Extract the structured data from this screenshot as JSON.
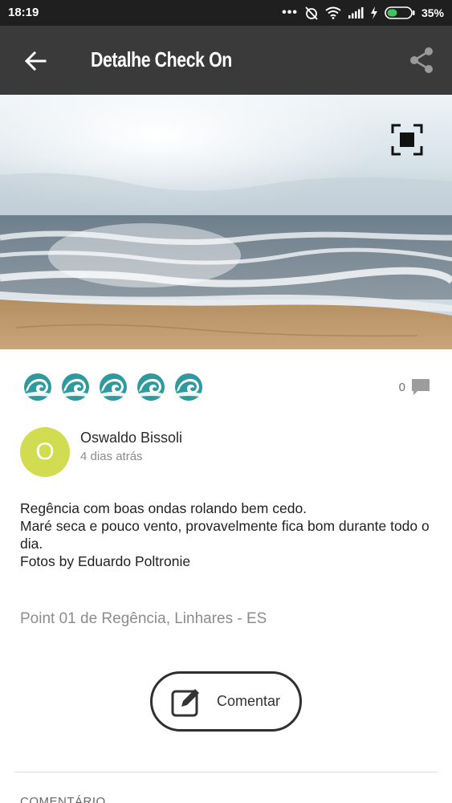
{
  "status_bar": {
    "time": "18:19",
    "battery": "35%",
    "icons": [
      "more-dots-icon",
      "alarm-off-icon",
      "wifi-icon",
      "signal-icon",
      "charging-icon",
      "battery-icon"
    ]
  },
  "app_bar": {
    "title": "Detalhe Check On",
    "back_icon": "arrow-back-icon",
    "share_icon": "share-icon"
  },
  "photo": {
    "expand_icon": "fullscreen-icon"
  },
  "rating": {
    "waves": 5,
    "wave_color": "#2e9a9e",
    "comment_count": "0",
    "comment_icon": "comment-bubble-icon"
  },
  "author": {
    "initial": "O",
    "name": "Oswaldo Bissoli",
    "time_ago": "4 dias atrás",
    "avatar_color": "#d2dc50"
  },
  "post": {
    "lines": [
      "Regência com boas ondas rolando bem cedo.",
      "Maré seca e pouco vento, provavelmente fica bom durante todo o dia.",
      "Fotos by Eduardo Poltronie"
    ],
    "location": "Point 01 de Regência, Linhares - ES"
  },
  "actions": {
    "comment_label": "Comentar",
    "comment_icon": "edit-icon"
  },
  "comments_section": {
    "label": "COMENTÁRIO"
  }
}
